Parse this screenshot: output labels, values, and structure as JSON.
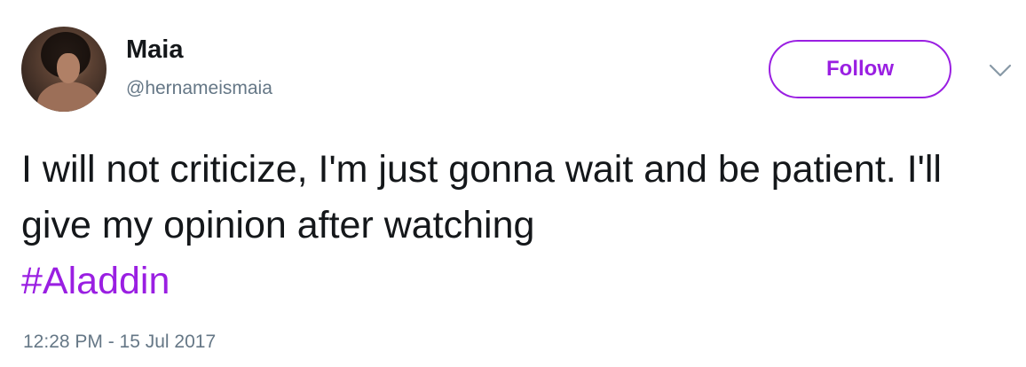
{
  "user": {
    "name": "Maia",
    "handle": "@hernameismaia"
  },
  "header": {
    "follow_label": "Follow",
    "menu_icon": "chevron-down-icon"
  },
  "tweet": {
    "text": "I will not criticize, I'm just gonna wait and be patient. I'll give my opinion after watching",
    "hashtag": "#Aladdin",
    "timestamp": "12:28 PM - 15 Jul 2017"
  },
  "colors": {
    "accent": "#9a1fe2",
    "text": "#14171a",
    "secondary": "#657786"
  }
}
